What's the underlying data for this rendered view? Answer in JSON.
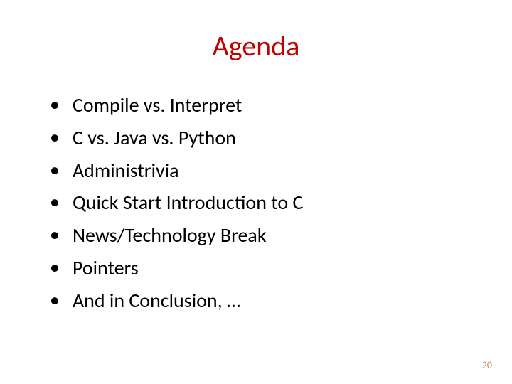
{
  "slide": {
    "title": "Agenda",
    "bullets": [
      "Compile vs. Interpret",
      "C vs. Java vs. Python",
      "Administrivia",
      "Quick Start Introduction to C",
      "News/Technology Break",
      "Pointers",
      "And in Conclusion, …"
    ],
    "page_number": "20"
  }
}
